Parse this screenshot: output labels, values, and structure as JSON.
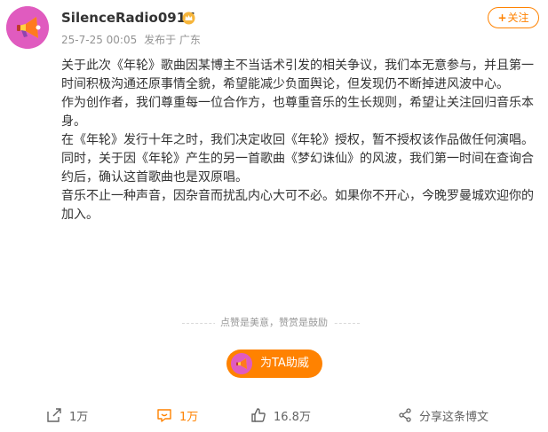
{
  "post": {
    "username": "SilenceRadio0917",
    "date": "25-7-25 00:05",
    "source": "发布于 广东",
    "follow_label": "关注",
    "follow_plus": "+",
    "paragraphs": [
      "关于此次《年轮》歌曲因某博主不当话术引发的相关争议，我们本无意参与，并且第一时间积极沟通还原事情全貌，希望能减少负面舆论，但发现仍不断掉进风波中心。",
      "作为创作者，我们尊重每一位合作方，也尊重音乐的生长规则，希望让关注回归音乐本身。",
      "在《年轮》发行十年之时，我们决定收回《年轮》授权，暂不授权该作品做任何演唱。",
      "同时，关于因《年轮》产生的另一首歌曲《梦幻诛仙》的风波，我们第一时间在查询合约后，确认这首歌曲也是双原唱。",
      "音乐不止一种声音，因杂音而扰乱内心大可不必。如果你不开心，今晚罗曼城欢迎你的加入。"
    ]
  },
  "reward": {
    "divider_text": "点赞是美意，赞赏是鼓励",
    "button_label": "为TA助威"
  },
  "actions": {
    "repost": "1万",
    "comment": "1万",
    "like": "16.8万",
    "share": "分享这条博文"
  },
  "icons": {
    "avatar": "megaphone-avatar",
    "vip": "crown-icon",
    "repost": "share-arrow-icon",
    "comment": "comment-icon",
    "like": "thumbs-up-icon",
    "share": "share-nodes-icon"
  },
  "colors": {
    "accent": "#ff8200",
    "avatar_bg": "#e05bbf",
    "muted": "#939393"
  }
}
